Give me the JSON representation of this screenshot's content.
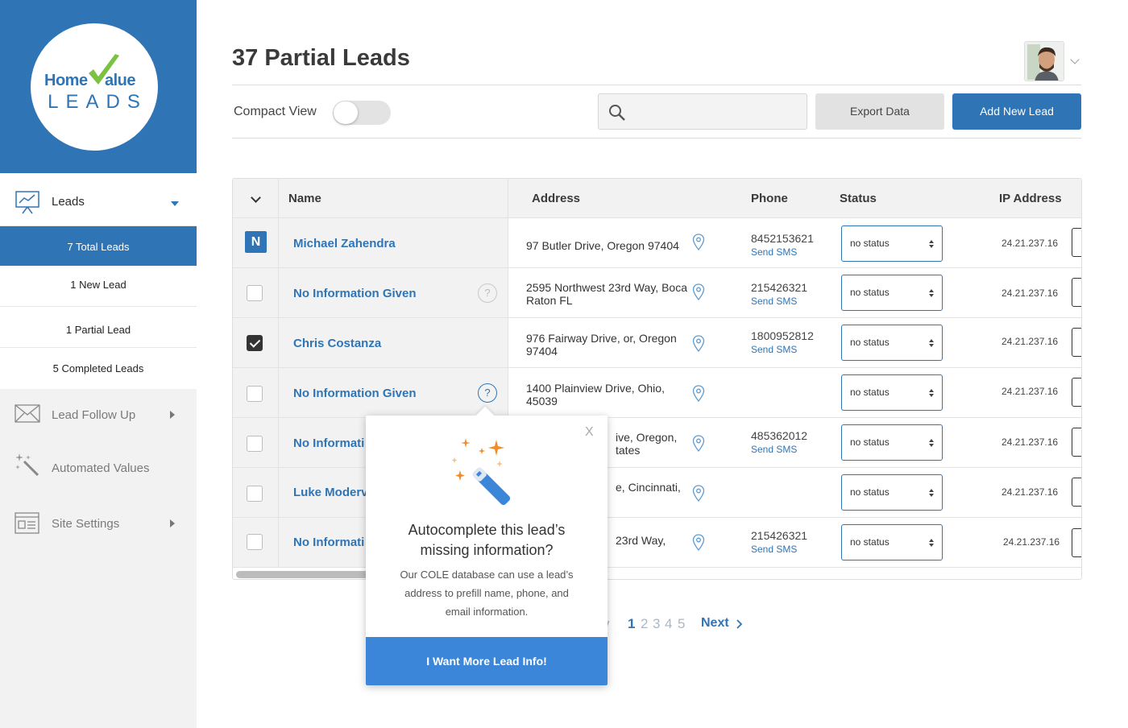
{
  "logo": {
    "word1": "Home",
    "word2": "alue",
    "word3": "LEADS"
  },
  "sidebar": {
    "leads_label": "Leads",
    "sub_items": [
      "7 Total Leads",
      "1 New Lead",
      "1 Partial Lead",
      "5 Completed Leads"
    ],
    "items": [
      {
        "label": "Lead Follow Up",
        "icon": "envelope-icon"
      },
      {
        "label": "Automated Values",
        "icon": "magic-wand-icon"
      },
      {
        "label": "Site Settings",
        "icon": "browser-settings-icon"
      }
    ]
  },
  "header": {
    "title": "37 Partial Leads",
    "compact_view_label": "Compact View",
    "compact_view_on": false,
    "search_placeholder": "",
    "export_label": "Export Data",
    "add_label": "Add New Lead"
  },
  "table": {
    "columns": [
      "Name",
      "Address",
      "Phone",
      "Status",
      "IP Address"
    ],
    "rows": [
      {
        "badge": "N",
        "checked": false,
        "name": "Michael Zahendra",
        "address": "97 Butler Drive, Oregon 97404",
        "phone": "8452153621",
        "sms": "Send SMS",
        "status": "no status",
        "ip": "24.21.237.16"
      },
      {
        "checked": false,
        "name": "No Information Given",
        "address": "2595 Northwest 23rd Way, Boca Raton FL",
        "phone": "215426321",
        "sms": "Send SMS",
        "status": "no status",
        "ip": "24.21.237.16"
      },
      {
        "checked": true,
        "name": "Chris Costanza",
        "address": "976 Fairway Drive, or, Oregon 97404",
        "phone": "1800952812",
        "sms": "Send SMS",
        "status": "no status",
        "ip": "24.21.237.16"
      },
      {
        "checked": false,
        "name": "No Information Given",
        "address": "1400 Plainview Drive, Ohio, 45039",
        "phone": "",
        "sms": "",
        "status": "no status",
        "ip": "24.21.237.16"
      },
      {
        "checked": false,
        "name": "No Informati",
        "address": "ive, Oregon, tates",
        "phone": "485362012",
        "sms": "Send SMS",
        "status": "no status",
        "ip": "24.21.237.16"
      },
      {
        "checked": false,
        "name": "Luke Moderv",
        "address": "e, Cincinnati,",
        "phone": "",
        "sms": "",
        "status": "no status",
        "ip": "24.21.237.16"
      },
      {
        "checked": false,
        "name": "No Informati",
        "address": "23rd Way,",
        "phone": "215426321",
        "sms": "Send SMS",
        "status": "no status",
        "ip": "24.21.237.16"
      }
    ]
  },
  "pagination": {
    "prev_fragment": "v",
    "current": "1",
    "pages": [
      "2",
      "3",
      "4",
      "5"
    ],
    "next_label": "Next"
  },
  "popover": {
    "close": "X",
    "title": "Autocomplete this lead’s missing information?",
    "body": "Our COLE database can use a lead’s address to prefill name, phone, and email information.",
    "button": "I Want More Lead Info!"
  },
  "colors": {
    "brand": "#2f75b6",
    "popover_button": "#3b86d8",
    "sidebar_bg": "#f2f2f2"
  }
}
